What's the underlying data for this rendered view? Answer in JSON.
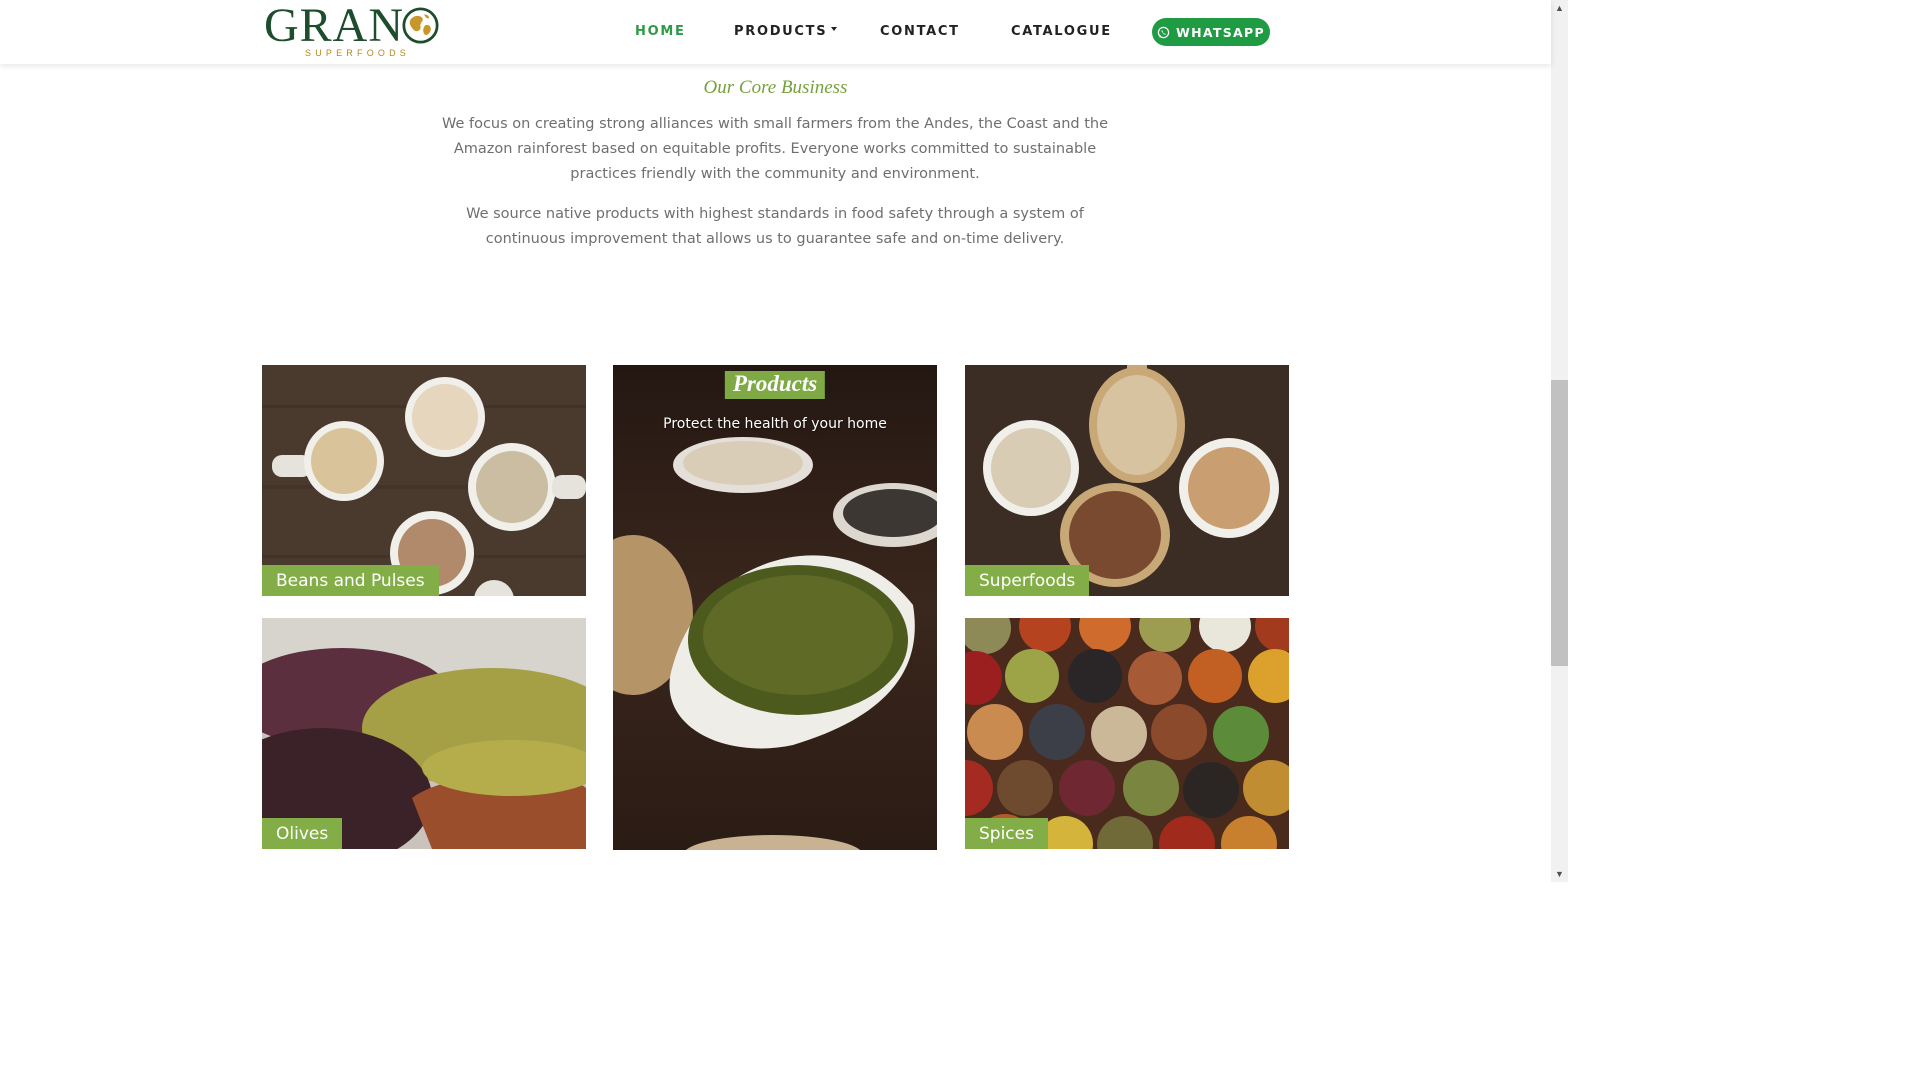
{
  "header": {
    "logo_text": "GRANO",
    "logo_subtext": "SUPERFOODS",
    "nav": [
      {
        "label": "HOME",
        "active": true
      },
      {
        "label": "PRODUCTS",
        "has_dropdown": true
      },
      {
        "label": "CONTACT"
      },
      {
        "label": "CATALOGUE"
      }
    ],
    "whatsapp_label": "WHATSAPP"
  },
  "about": {
    "title": "Our Core Business",
    "paragraph_1": "We focus on creating strong alliances with small farmers from the Andes, the Coast and the Amazon rainforest based on equitable profits. Everyone works committed to sustainable practices friendly with the community and environment.",
    "paragraph_2": "We source native products with highest standards in food safety through a system of continuous improvement that allows us to guarantee safe and on-time delivery."
  },
  "products": {
    "title": "Products",
    "subtitle": "Protect the health of your home",
    "tiles": [
      {
        "label": "Beans and Pulses"
      },
      {
        "label": "Superfoods"
      },
      {
        "label": "Olives"
      },
      {
        "label": "Spices"
      }
    ]
  },
  "colors": {
    "brand_green": "#1d4d2c",
    "accent_green": "#83ad46",
    "nav_active": "#2e9a47",
    "whatsapp_green": "#1f9b43",
    "logo_gold": "#b08a1e"
  },
  "icons": {
    "whatsapp": "whatsapp-icon",
    "dropdown": "chevron-down-icon",
    "globe": "globe-icon"
  }
}
